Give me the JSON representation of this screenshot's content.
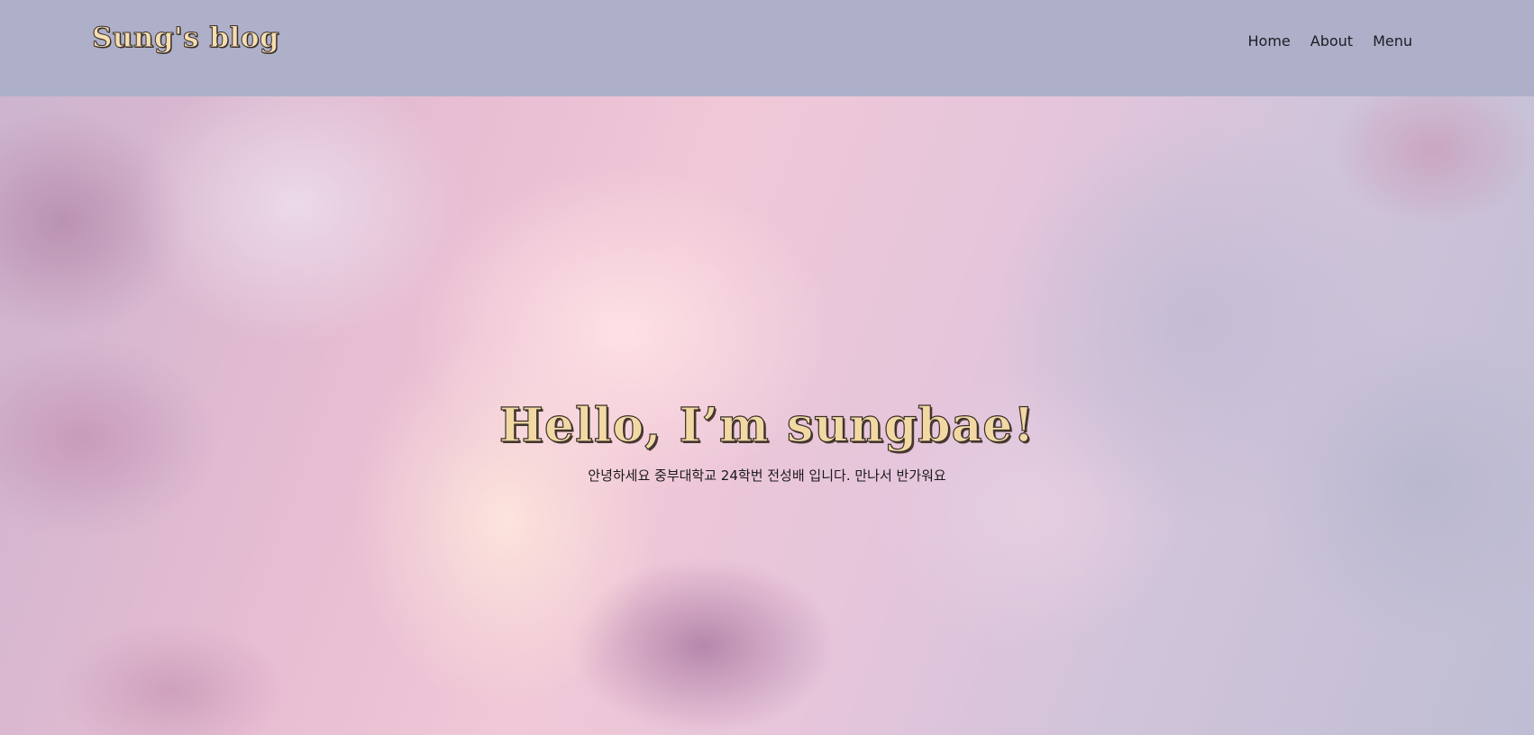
{
  "header": {
    "brand": "Sung's blog",
    "nav": [
      {
        "label": "Home"
      },
      {
        "label": "About"
      },
      {
        "label": "Menu"
      }
    ]
  },
  "hero": {
    "title": "Hello, I’m sungbae!",
    "subtitle": "안녕하세요 중부대학교 24학번 전성배 입니다. 만나서 반가워요",
    "background": "pink-lavender-cloud-sky"
  },
  "colors": {
    "header_bg": "#aeb0c9",
    "title_fill": "#f2d9a4",
    "title_outline": "#3a2f2a",
    "nav_text": "#1c1c24"
  }
}
